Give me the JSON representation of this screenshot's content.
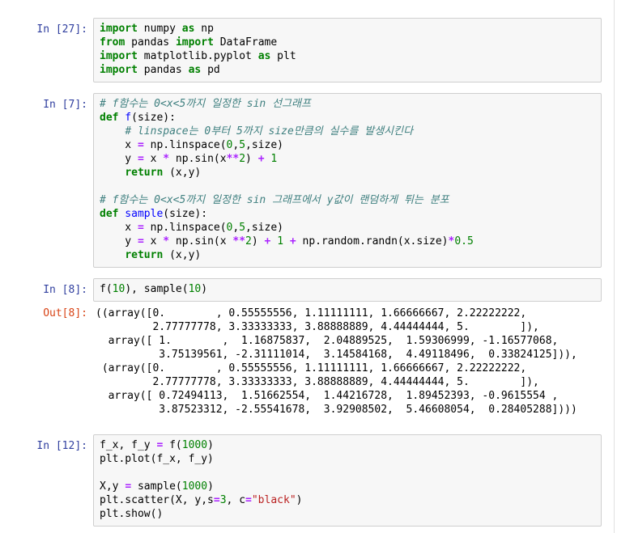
{
  "cells": [
    {
      "prompt": "In [27]:",
      "lines": [
        [
          {
            "t": "import",
            "c": "kw"
          },
          {
            "t": " numpy ",
            "c": "pl"
          },
          {
            "t": "as",
            "c": "kw"
          },
          {
            "t": " np",
            "c": "pl"
          }
        ],
        [
          {
            "t": "from",
            "c": "kw"
          },
          {
            "t": " pandas ",
            "c": "pl"
          },
          {
            "t": "import",
            "c": "kw"
          },
          {
            "t": " DataFrame",
            "c": "pl"
          }
        ],
        [
          {
            "t": "import",
            "c": "kw"
          },
          {
            "t": " matplotlib.pyplot ",
            "c": "pl"
          },
          {
            "t": "as",
            "c": "kw"
          },
          {
            "t": " plt",
            "c": "pl"
          }
        ],
        [
          {
            "t": "import",
            "c": "kw"
          },
          {
            "t": " pandas ",
            "c": "pl"
          },
          {
            "t": "as",
            "c": "kw"
          },
          {
            "t": " pd",
            "c": "pl"
          }
        ]
      ]
    },
    {
      "prompt": "In [7]:",
      "lines": [
        [
          {
            "t": "# f함수는 0<x<5까지 일정한 sin 선그래프",
            "c": "com"
          }
        ],
        [
          {
            "t": "def",
            "c": "kw"
          },
          {
            "t": " f",
            "c": "fn"
          },
          {
            "t": "(size):",
            "c": "pl"
          }
        ],
        [
          {
            "t": "    ",
            "c": "pl"
          },
          {
            "t": "# linspace는 0부터 5까지 size만큼의 실수를 발생시킨다",
            "c": "com"
          }
        ],
        [
          {
            "t": "    x ",
            "c": "pl"
          },
          {
            "t": "=",
            "c": "op"
          },
          {
            "t": " np.linspace(",
            "c": "pl"
          },
          {
            "t": "0",
            "c": "num"
          },
          {
            "t": ",",
            "c": "pl"
          },
          {
            "t": "5",
            "c": "num"
          },
          {
            "t": ",size)",
            "c": "pl"
          }
        ],
        [
          {
            "t": "    y ",
            "c": "pl"
          },
          {
            "t": "=",
            "c": "op"
          },
          {
            "t": " x ",
            "c": "pl"
          },
          {
            "t": "*",
            "c": "op"
          },
          {
            "t": " np.sin(x",
            "c": "pl"
          },
          {
            "t": "**",
            "c": "op"
          },
          {
            "t": "2",
            "c": "num"
          },
          {
            "t": ") ",
            "c": "pl"
          },
          {
            "t": "+",
            "c": "op"
          },
          {
            "t": " ",
            "c": "pl"
          },
          {
            "t": "1",
            "c": "num"
          }
        ],
        [
          {
            "t": "    ",
            "c": "pl"
          },
          {
            "t": "return",
            "c": "kw"
          },
          {
            "t": " (x,y)",
            "c": "pl"
          }
        ],
        [
          {
            "t": "",
            "c": "pl"
          }
        ],
        [
          {
            "t": "# f함수는 0<x<5까지 일정한 sin 그래프에서 y값이 랜덤하게 튀는 분포",
            "c": "com"
          }
        ],
        [
          {
            "t": "def",
            "c": "kw"
          },
          {
            "t": " sample",
            "c": "fn"
          },
          {
            "t": "(size):",
            "c": "pl"
          }
        ],
        [
          {
            "t": "    x ",
            "c": "pl"
          },
          {
            "t": "=",
            "c": "op"
          },
          {
            "t": " np.linspace(",
            "c": "pl"
          },
          {
            "t": "0",
            "c": "num"
          },
          {
            "t": ",",
            "c": "pl"
          },
          {
            "t": "5",
            "c": "num"
          },
          {
            "t": ",size)",
            "c": "pl"
          }
        ],
        [
          {
            "t": "    y ",
            "c": "pl"
          },
          {
            "t": "=",
            "c": "op"
          },
          {
            "t": " x ",
            "c": "pl"
          },
          {
            "t": "*",
            "c": "op"
          },
          {
            "t": " np.sin(x ",
            "c": "pl"
          },
          {
            "t": "**",
            "c": "op"
          },
          {
            "t": "2",
            "c": "num"
          },
          {
            "t": ") ",
            "c": "pl"
          },
          {
            "t": "+",
            "c": "op"
          },
          {
            "t": " ",
            "c": "pl"
          },
          {
            "t": "1",
            "c": "num"
          },
          {
            "t": " ",
            "c": "pl"
          },
          {
            "t": "+",
            "c": "op"
          },
          {
            "t": " np.random.randn(x.size)",
            "c": "pl"
          },
          {
            "t": "*",
            "c": "op"
          },
          {
            "t": "0.5",
            "c": "num"
          }
        ],
        [
          {
            "t": "    ",
            "c": "pl"
          },
          {
            "t": "return",
            "c": "kw"
          },
          {
            "t": " (x,y)",
            "c": "pl"
          }
        ]
      ]
    },
    {
      "prompt": "In [8]:",
      "lines": [
        [
          {
            "t": "f(",
            "c": "pl"
          },
          {
            "t": "10",
            "c": "num"
          },
          {
            "t": "), sample(",
            "c": "pl"
          },
          {
            "t": "10",
            "c": "num"
          },
          {
            "t": ")",
            "c": "pl"
          }
        ]
      ],
      "output_prompt": "Out[8]:",
      "output_lines": [
        "((array([0.        , 0.55555556, 1.11111111, 1.66666667, 2.22222222,",
        "         2.77777778, 3.33333333, 3.88888889, 4.44444444, 5.        ]),",
        "  array([ 1.        ,  1.16875837,  2.04889525,  1.59306999, -1.16577068,",
        "          3.75139561, -2.31111014,  3.14584168,  4.49118496,  0.33824125])),",
        " (array([0.        , 0.55555556, 1.11111111, 1.66666667, 2.22222222,",
        "         2.77777778, 3.33333333, 3.88888889, 4.44444444, 5.        ]),",
        "  array([ 0.72494113,  1.51662554,  1.44216728,  1.89452393, -0.9615554 ,",
        "          3.87523312, -2.55541678,  3.92908502,  5.46608054,  0.28405288])))"
      ]
    },
    {
      "prompt": "In [12]:",
      "lines": [
        [
          {
            "t": "f_x, f_y ",
            "c": "pl"
          },
          {
            "t": "=",
            "c": "op"
          },
          {
            "t": " f(",
            "c": "pl"
          },
          {
            "t": "1000",
            "c": "num"
          },
          {
            "t": ")",
            "c": "pl"
          }
        ],
        [
          {
            "t": "plt.plot(f_x, f_y)",
            "c": "pl"
          }
        ],
        [
          {
            "t": "",
            "c": "pl"
          }
        ],
        [
          {
            "t": "X,y ",
            "c": "pl"
          },
          {
            "t": "=",
            "c": "op"
          },
          {
            "t": " sample(",
            "c": "pl"
          },
          {
            "t": "1000",
            "c": "num"
          },
          {
            "t": ")",
            "c": "pl"
          }
        ],
        [
          {
            "t": "plt.scatter(X, y,s",
            "c": "pl"
          },
          {
            "t": "=",
            "c": "op"
          },
          {
            "t": "3",
            "c": "num"
          },
          {
            "t": ", c",
            "c": "pl"
          },
          {
            "t": "=",
            "c": "op"
          },
          {
            "t": "\"black\"",
            "c": "str"
          },
          {
            "t": ")",
            "c": "pl"
          }
        ],
        [
          {
            "t": "plt.show()",
            "c": "pl"
          }
        ]
      ]
    }
  ]
}
